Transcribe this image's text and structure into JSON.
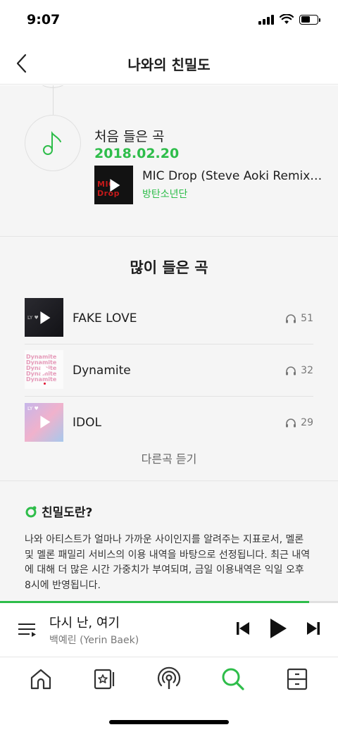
{
  "status_bar": {
    "time": "9:07"
  },
  "header": {
    "title": "나와의 친밀도"
  },
  "first_listen": {
    "label": "처음 들은 곡",
    "date": "2018.02.20",
    "song": {
      "title": "MIC Drop (Steve Aoki Remix)...",
      "artist": "방탄소년단",
      "cover_text": "MIC Drop"
    }
  },
  "most_listened": {
    "title": "많이 들은 곡",
    "items": [
      {
        "title": "FAKE LOVE",
        "count": "51",
        "cover_text": "LY ♥"
      },
      {
        "title": "Dynamite",
        "count": "32",
        "cover_text": "Dynamite"
      },
      {
        "title": "IDOL",
        "count": "29",
        "cover_text": "LY ♥"
      }
    ],
    "more_label": "다른곡 듣기"
  },
  "about": {
    "title": "친밀도란?",
    "description": "나와 아티스트가 얼마나 가까운 사이인지를 알려주는 지표로서, 멜론 및 멜론 패밀리 서비스의 이용 내역을 바탕으로 선정됩니다. 최근 내역에 대해 더 많은 시간 가중치가 부여되며, 금일 이용내역은 익일 오후 8시에 반영됩니다."
  },
  "player": {
    "track_title": "다시 난, 여기",
    "track_artist": "백예린 (Yerin Baek)",
    "progress": 0.915
  },
  "bottom_nav": {
    "items": [
      {
        "icon": "home-icon",
        "active": false
      },
      {
        "icon": "library-icon",
        "active": false
      },
      {
        "icon": "podcast-icon",
        "active": false
      },
      {
        "icon": "search-icon",
        "active": true
      },
      {
        "icon": "drawer-icon",
        "active": false
      }
    ]
  },
  "colors": {
    "accent": "#2ebd4a",
    "text": "#1c1c1c",
    "muted": "#777777",
    "background": "#f5f5f5"
  }
}
